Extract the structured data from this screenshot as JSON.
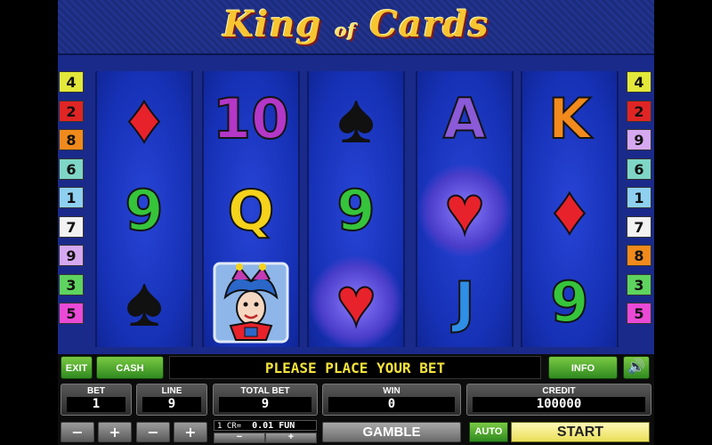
{
  "game": {
    "title_left": "King",
    "title_mid": "of",
    "title_right": "Cards"
  },
  "lines": {
    "left": [
      {
        "n": "4",
        "color": "#e3e83a"
      },
      {
        "n": "2",
        "color": "#e02525"
      },
      {
        "n": "8",
        "color": "#f08a1c"
      },
      {
        "n": "6",
        "color": "#7fd6c6"
      },
      {
        "n": "1",
        "color": "#8fd0f0"
      },
      {
        "n": "7",
        "color": "#f2f2f2"
      },
      {
        "n": "9",
        "color": "#d6a8f0"
      },
      {
        "n": "3",
        "color": "#5fd35f"
      },
      {
        "n": "5",
        "color": "#ea4ad6"
      }
    ],
    "right": [
      {
        "n": "4",
        "color": "#e3e83a"
      },
      {
        "n": "2",
        "color": "#e02525"
      },
      {
        "n": "9",
        "color": "#d6a8f0"
      },
      {
        "n": "6",
        "color": "#7fd6c6"
      },
      {
        "n": "1",
        "color": "#8fd0f0"
      },
      {
        "n": "7",
        "color": "#f2f2f2"
      },
      {
        "n": "8",
        "color": "#f08a1c"
      },
      {
        "n": "3",
        "color": "#5fd35f"
      },
      {
        "n": "5",
        "color": "#ea4ad6"
      }
    ]
  },
  "reels": [
    [
      {
        "kind": "suit",
        "glyph": "♦",
        "name": "diamond-icon",
        "color": "#e8222b"
      },
      {
        "kind": "text",
        "glyph": "9",
        "name": "nine-symbol",
        "color": "#36c43b"
      },
      {
        "kind": "suit",
        "glyph": "♠",
        "name": "spade-icon",
        "color": "#111111"
      }
    ],
    [
      {
        "kind": "text",
        "glyph": "10",
        "name": "ten-symbol",
        "color": "#b437c7"
      },
      {
        "kind": "text",
        "glyph": "Q",
        "name": "queen-symbol",
        "color": "#f5d21b"
      },
      {
        "kind": "joker",
        "glyph": "",
        "name": "joker-icon",
        "color": "#3a8fd6"
      }
    ],
    [
      {
        "kind": "suit",
        "glyph": "♠",
        "name": "spade-icon",
        "color": "#111111"
      },
      {
        "kind": "text",
        "glyph": "9",
        "name": "nine-symbol",
        "color": "#36c43b"
      },
      {
        "kind": "suit",
        "glyph": "♥",
        "name": "heart-icon",
        "color": "#e8222b",
        "glow": true
      }
    ],
    [
      {
        "kind": "text",
        "glyph": "A",
        "name": "ace-symbol",
        "color": "#8b5ad8"
      },
      {
        "kind": "suit",
        "glyph": "♥",
        "name": "heart-icon",
        "color": "#e8222b",
        "glow": true
      },
      {
        "kind": "text",
        "glyph": "J",
        "name": "jack-symbol",
        "color": "#2f8ee6"
      }
    ],
    [
      {
        "kind": "text",
        "glyph": "K",
        "name": "king-symbol",
        "color": "#f28a1c"
      },
      {
        "kind": "suit",
        "glyph": "♦",
        "name": "diamond-icon",
        "color": "#e8222b"
      },
      {
        "kind": "text",
        "glyph": "9",
        "name": "nine-symbol",
        "color": "#36c43b"
      }
    ]
  ],
  "controls": {
    "exit": "EXIT",
    "cash": "CASH",
    "message": "PLEASE PLACE YOUR BET",
    "info": "INFO",
    "sound_icon": "speaker-icon",
    "bet_label": "BET",
    "bet_value": "1",
    "line_label": "LINE",
    "line_value": "9",
    "total_bet_label": "TOTAL BET",
    "total_bet_value": "9",
    "win_label": "WIN",
    "win_value": "0",
    "credit_label": "CREDIT",
    "credit_value": "100000",
    "minus": "−",
    "plus": "+",
    "coin_label": "1 CR=",
    "coin_value": "0.01 FUN",
    "gamble": "GAMBLE",
    "auto": "AUTO",
    "start": "START"
  }
}
